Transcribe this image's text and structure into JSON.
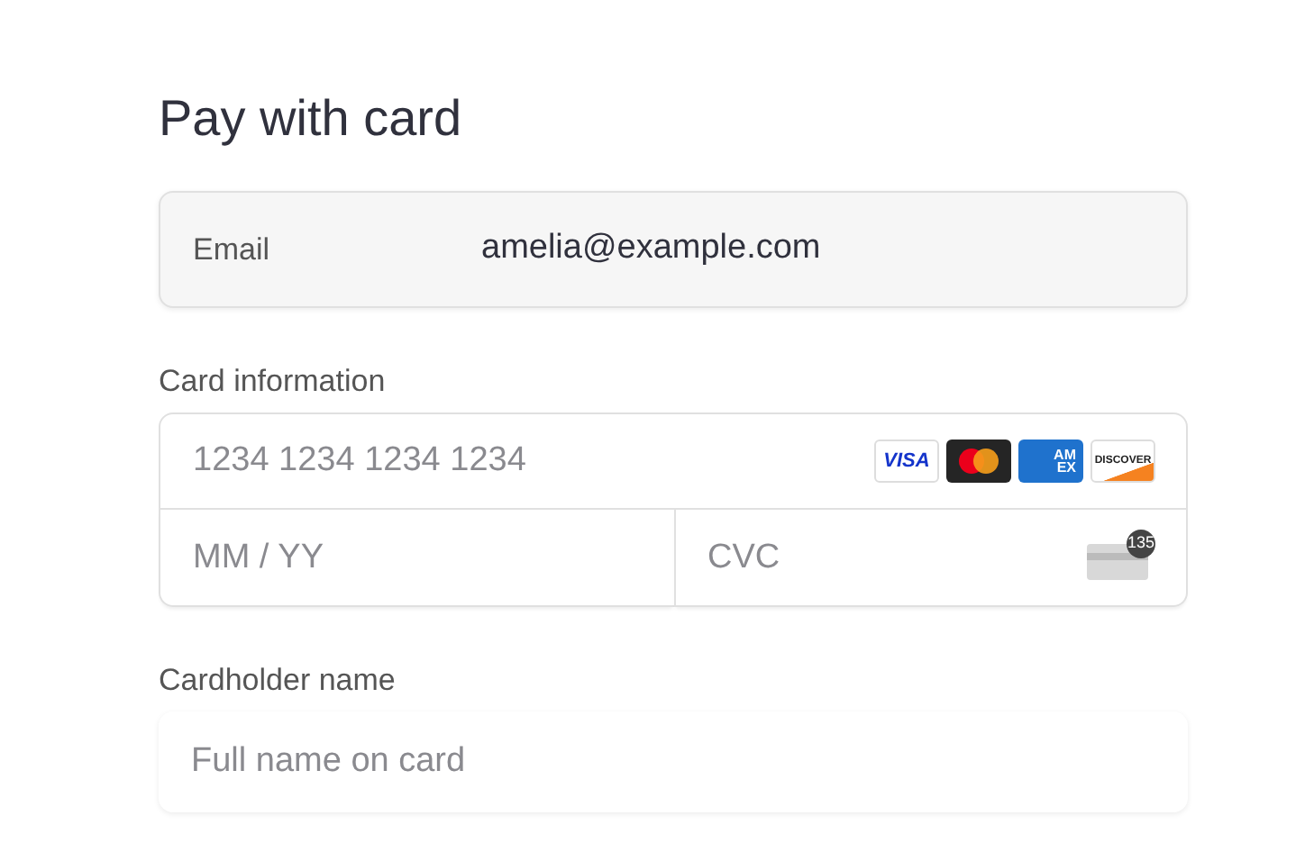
{
  "title": "Pay with card",
  "email": {
    "label": "Email",
    "value": "amelia@example.com"
  },
  "card_information": {
    "label": "Card information",
    "number": {
      "placeholder": "1234 1234 1234 1234"
    },
    "brands": [
      {
        "kind": "visa",
        "label": "VISA"
      },
      {
        "kind": "mastercard"
      },
      {
        "kind": "amex",
        "label": "AM",
        "label_2": "EX"
      },
      {
        "kind": "discover",
        "label": "DISCOVER"
      }
    ],
    "expiry": {
      "placeholder": "MM / YY"
    },
    "cvc": {
      "placeholder": "CVC",
      "hint": "135"
    }
  },
  "cardholder": {
    "label": "Cardholder name",
    "placeholder": "Full name on card"
  }
}
